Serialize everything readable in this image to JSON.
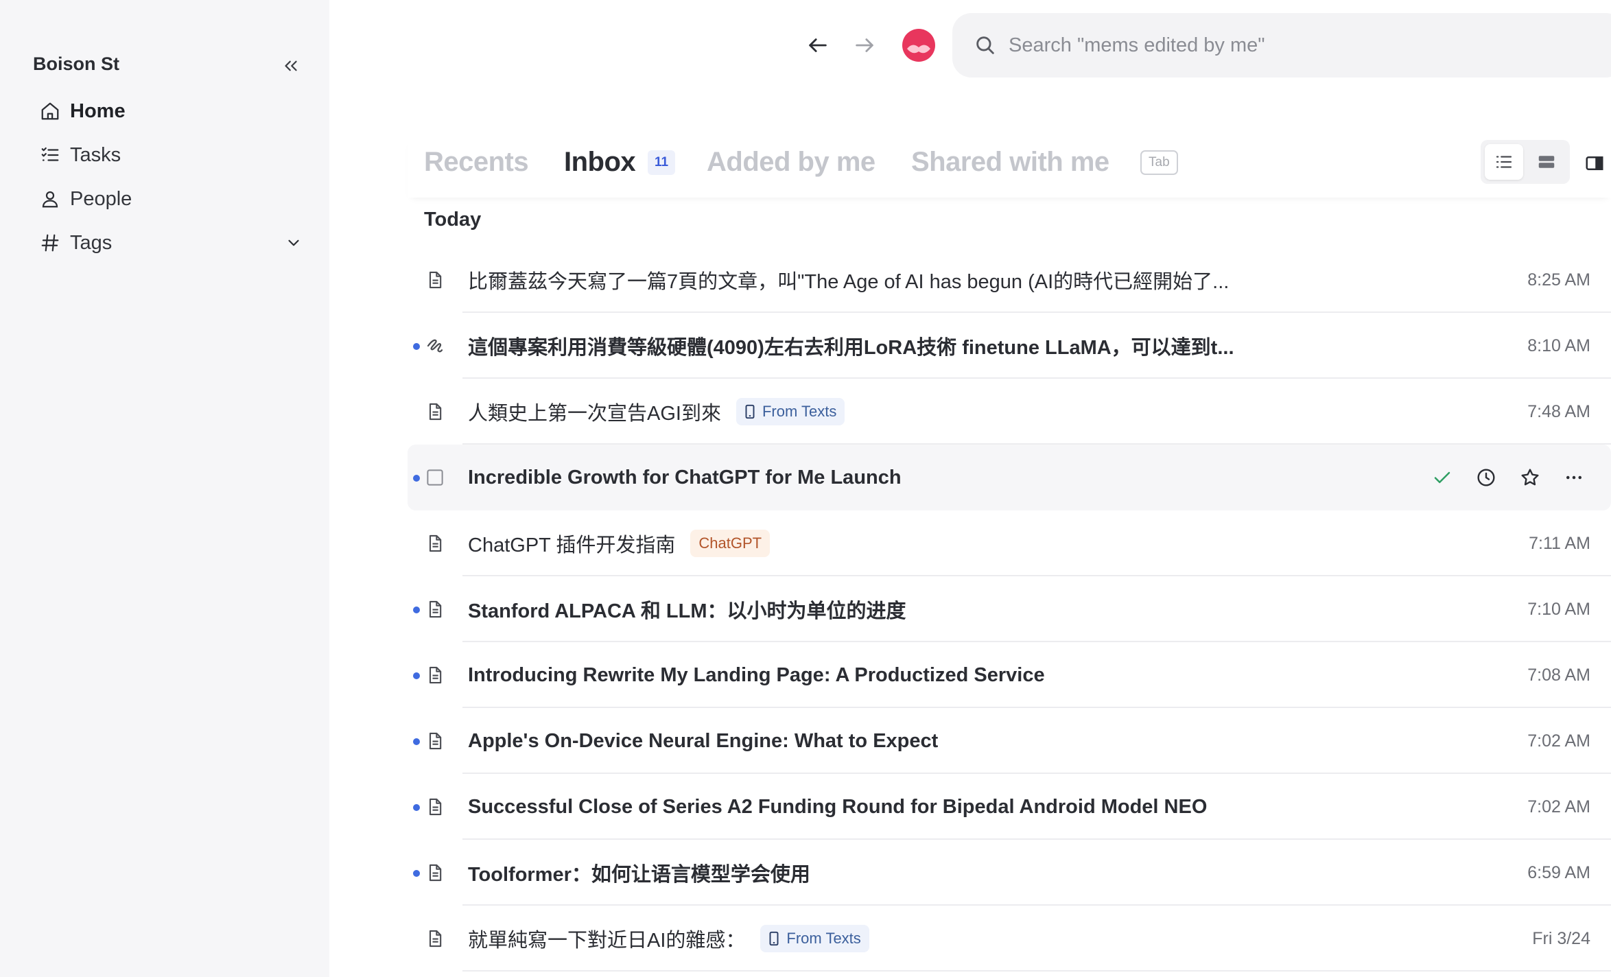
{
  "sidebar": {
    "workspace": "Boison St",
    "items": [
      {
        "label": "Home",
        "icon": "home-icon",
        "active": true
      },
      {
        "label": "Tasks",
        "icon": "tasks-icon"
      },
      {
        "label": "People",
        "icon": "person-icon"
      },
      {
        "label": "Tags",
        "icon": "hash-icon"
      }
    ]
  },
  "search": {
    "placeholder": "Search \"mems edited by me\""
  },
  "tabs": {
    "recents": "Recents",
    "inbox": "Inbox",
    "inbox_count": "11",
    "added": "Added by me",
    "shared": "Shared with me",
    "shortcut": "Tab"
  },
  "section_label": "Today",
  "rows": [
    {
      "title": "比爾蓋茲今天寫了一篇7頁的文章，叫\"The Age of AI has begun (AI的時代已經開始了...",
      "time": "8:25 AM",
      "unread": false,
      "icon": "document-icon"
    },
    {
      "title": "這個專案利用消費等級硬體(4090)左右去利用LoRA技術 finetune LLaMA，可以達到t...",
      "time": "8:10 AM",
      "unread": true,
      "icon": "scribble-icon"
    },
    {
      "title": "人類史上第一次宣告AGI到來",
      "time": "7:48 AM",
      "unread": false,
      "icon": "document-icon",
      "chip": "From Texts"
    },
    {
      "title": "Incredible Growth for ChatGPT for Me Launch",
      "time": "",
      "unread": true,
      "icon": "checkbox-icon"
    },
    {
      "title": "ChatGPT 插件开发指南",
      "time": "7:11 AM",
      "unread": false,
      "icon": "document-icon",
      "chip": "ChatGPT"
    },
    {
      "title": "Stanford ALPACA 和 LLM：以小时为单位的进度",
      "time": "7:10 AM",
      "unread": true,
      "icon": "document-icon"
    },
    {
      "title": "Introducing Rewrite My Landing Page: A Productized Service",
      "time": "7:08 AM",
      "unread": true,
      "icon": "document-icon"
    },
    {
      "title": "Apple's On-Device Neural Engine: What to Expect",
      "time": "7:02 AM",
      "unread": true,
      "icon": "document-icon"
    },
    {
      "title": "Successful Close of Series A2 Funding Round for Bipedal Android Model NEO",
      "time": "7:02 AM",
      "unread": true,
      "icon": "document-icon"
    },
    {
      "title": "Toolformer：如何让语言模型学会使用",
      "time": "6:59 AM",
      "unread": true,
      "icon": "document-icon"
    },
    {
      "title": "就單純寫一下對近日AI的雜感：",
      "time": "Fri 3/24",
      "unread": false,
      "icon": "document-icon",
      "chip": "From Texts"
    }
  ],
  "colors": {
    "accent": "#3f6be0",
    "brand": "#e8365d",
    "check": "#2f9e63"
  }
}
